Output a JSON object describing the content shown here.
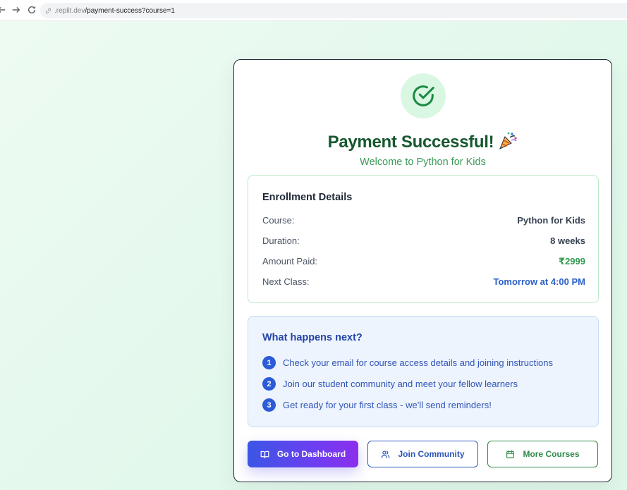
{
  "browser": {
    "url_host": ".replit.dev",
    "url_path": "/payment-success?course=1"
  },
  "header": {
    "title": "Payment Successful!",
    "subtitle": "Welcome to Python for Kids"
  },
  "enrollment": {
    "heading": "Enrollment Details",
    "rows": [
      {
        "label": "Course:",
        "value": "Python for Kids"
      },
      {
        "label": "Duration:",
        "value": "8 weeks"
      },
      {
        "label": "Amount Paid:",
        "value": "₹2999"
      },
      {
        "label": "Next Class:",
        "value": "Tomorrow at 4:00 PM"
      }
    ]
  },
  "next_steps": {
    "heading": "What happens next?",
    "items": [
      {
        "num": "1",
        "text": "Check your email for course access details and joining instructions"
      },
      {
        "num": "2",
        "text": "Join our student community and meet your fellow learners"
      },
      {
        "num": "3",
        "text": "Get ready for your first class - we'll send reminders!"
      }
    ]
  },
  "actions": {
    "dashboard_label": "Go to Dashboard",
    "community_label": "Join Community",
    "courses_label": "More Courses"
  },
  "colors": {
    "success_green": "#17582f",
    "accent_blue": "#2b5fc9",
    "gradient_start": "#3b56e6",
    "gradient_end": "#8b2fee"
  },
  "icons": [
    "back-arrow-icon",
    "forward-arrow-icon",
    "reload-icon",
    "link-icon",
    "check-circle-icon",
    "party-popper-icon",
    "book-icon",
    "users-icon",
    "calendar-icon"
  ]
}
